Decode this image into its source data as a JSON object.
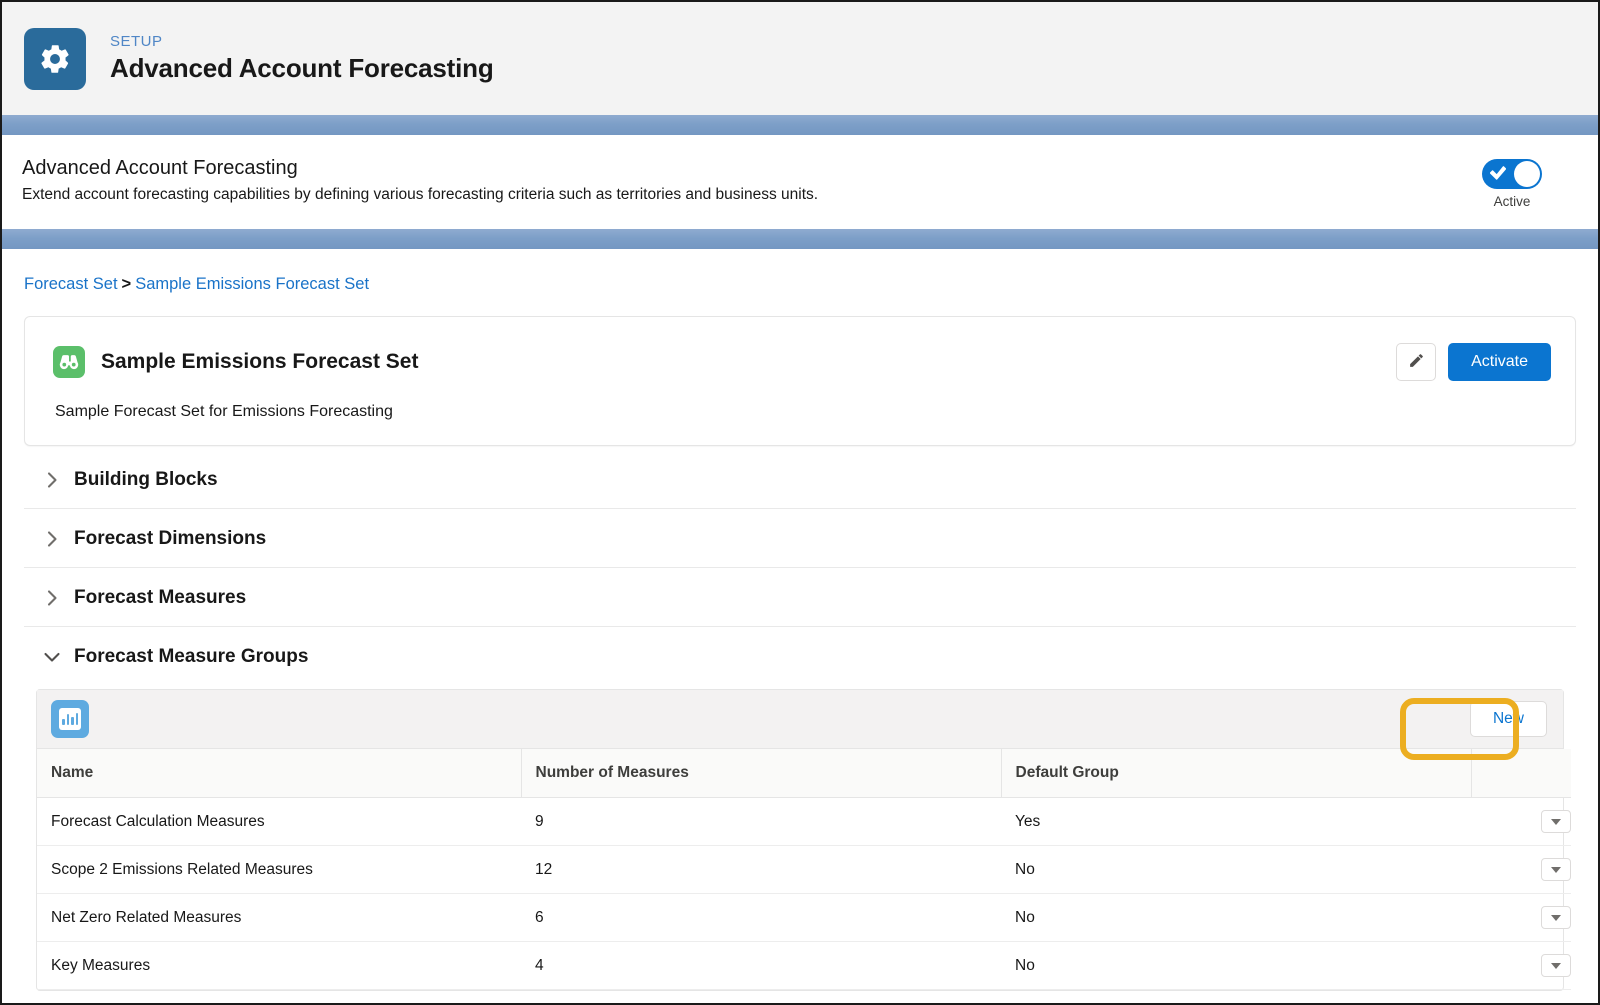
{
  "setup": {
    "eyebrow": "SETUP",
    "title": "Advanced Account Forecasting",
    "gear_icon": "gear-icon"
  },
  "feature": {
    "title": "Advanced Account Forecasting",
    "description": "Extend account forecasting capabilities by defining various forecasting criteria such as territories and business units.",
    "toggle_state_label": "Active",
    "toggle_on": true,
    "toggle_color": "#0b75d0"
  },
  "breadcrumb": {
    "parent": "Forecast Set",
    "separator": ">",
    "current": "Sample Emissions Forecast Set"
  },
  "record": {
    "icon": "binoculars-icon",
    "icon_color": "#5bbf6a",
    "title": "Sample Emissions Forecast Set",
    "description": "Sample Forecast Set for Emissions Forecasting",
    "edit_icon": "pencil-icon",
    "activate_label": "Activate",
    "activate_color": "#0b75d0"
  },
  "accordion": {
    "sections": [
      {
        "label": "Building Blocks",
        "expanded": false,
        "icon": "chevron-right-icon"
      },
      {
        "label": "Forecast Dimensions",
        "expanded": false,
        "icon": "chevron-right-icon"
      },
      {
        "label": "Forecast Measures",
        "expanded": false,
        "icon": "chevron-right-icon"
      },
      {
        "label": "Forecast Measure Groups",
        "expanded": true,
        "icon": "chevron-down-icon"
      }
    ]
  },
  "related_list": {
    "icon": "bar-chart-icon",
    "icon_color": "#5eaae0",
    "new_label": "New",
    "highlight_color": "#ecae21",
    "columns": [
      "Name",
      "Number of Measures",
      "Default Group"
    ],
    "rows": [
      {
        "name": "Forecast Calculation Measures",
        "number_of_measures": "9",
        "default_group": "Yes"
      },
      {
        "name": "Scope 2 Emissions Related Measures",
        "number_of_measures": "12",
        "default_group": "No"
      },
      {
        "name": "Net Zero Related Measures",
        "number_of_measures": "6",
        "default_group": "No"
      },
      {
        "name": "Key Measures",
        "number_of_measures": "4",
        "default_group": "No"
      }
    ],
    "row_menu_icon": "chevron-down-icon"
  }
}
